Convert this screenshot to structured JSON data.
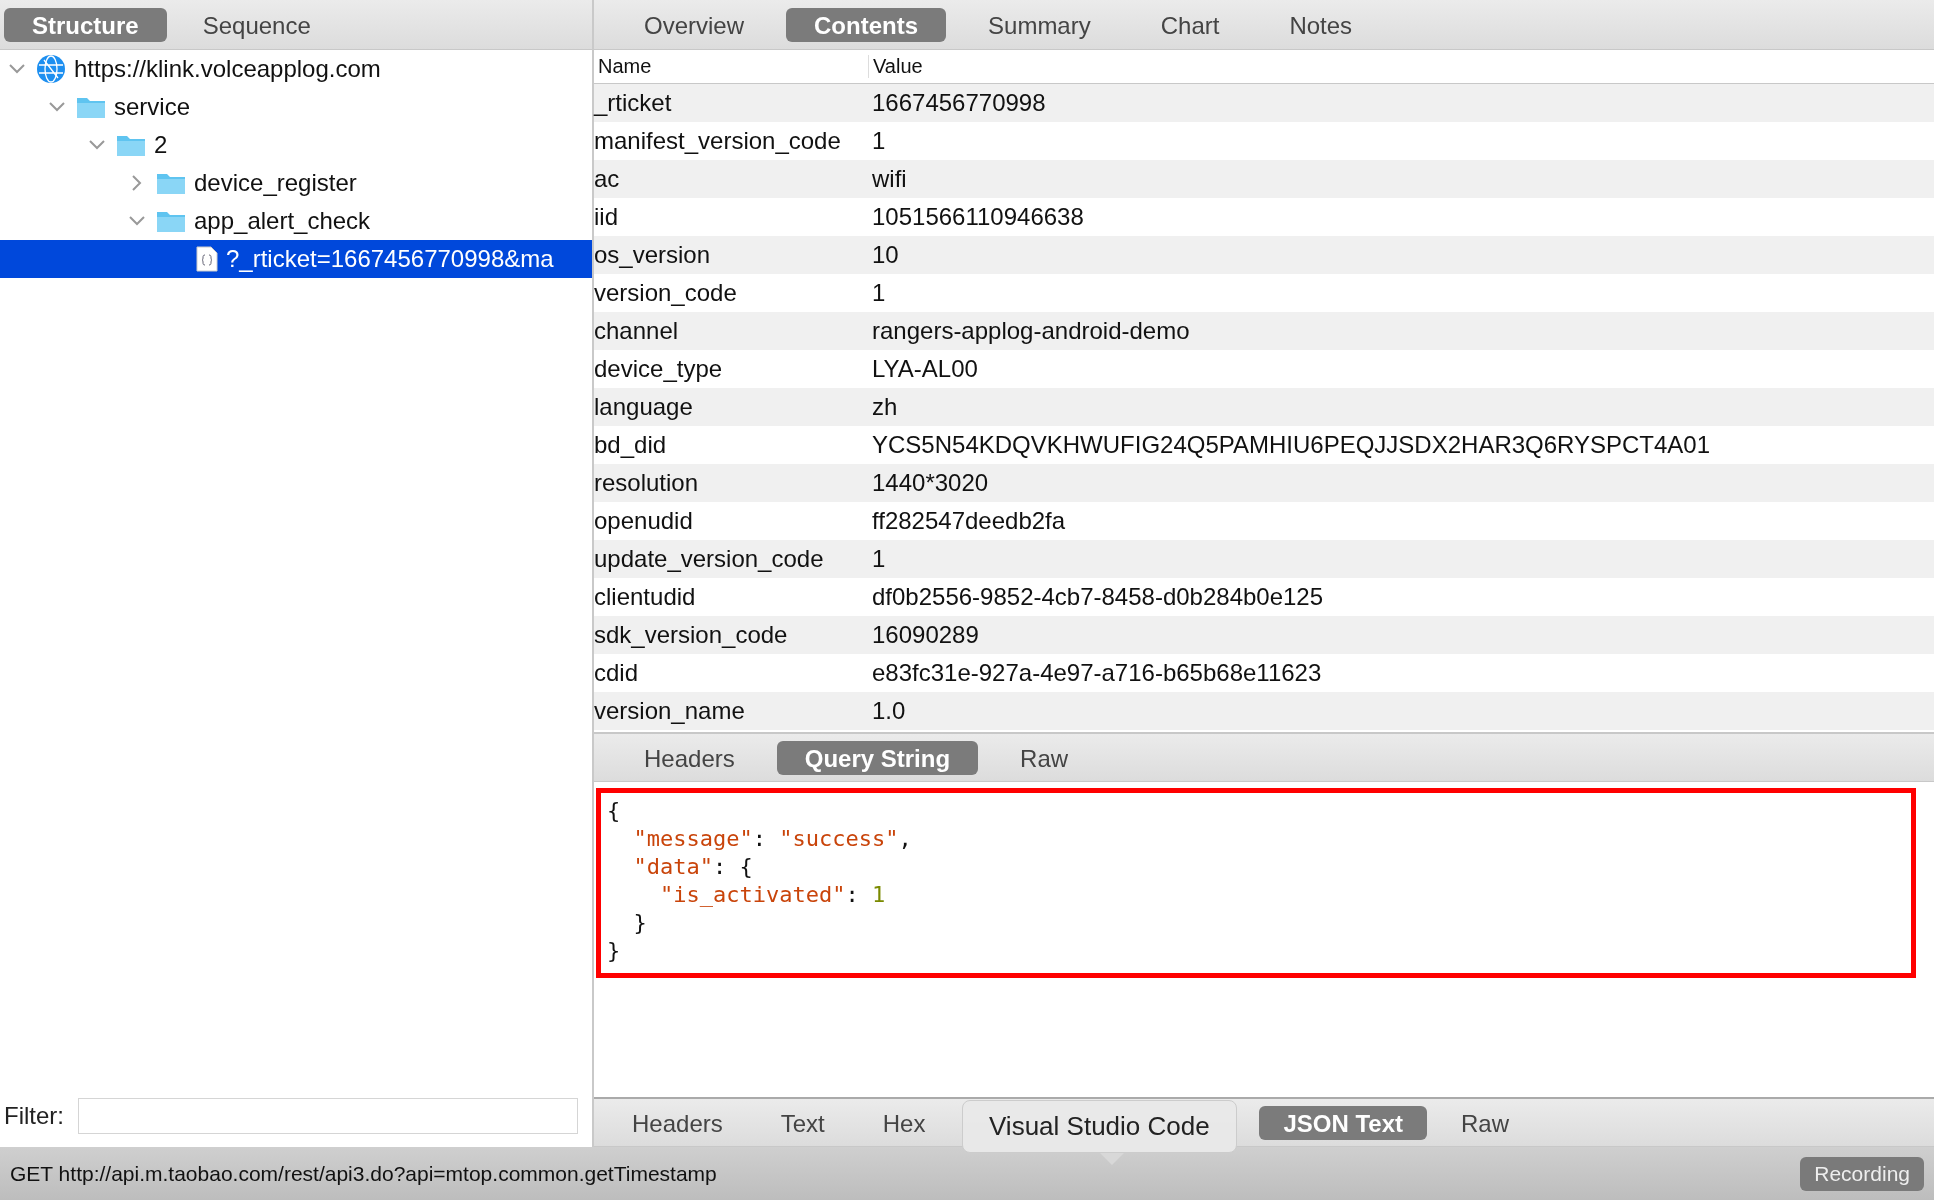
{
  "left_tabs": [
    {
      "label": "Structure",
      "selected": true
    },
    {
      "label": "Sequence",
      "selected": false
    }
  ],
  "tree": [
    {
      "label": "https://klink.volceapplog.com",
      "kind": "host",
      "expanded": true,
      "selected": false,
      "children": [
        {
          "label": "service",
          "kind": "folder",
          "expanded": true,
          "selected": false,
          "children": [
            {
              "label": "2",
              "kind": "folder",
              "expanded": true,
              "selected": false,
              "children": [
                {
                  "label": "device_register",
                  "kind": "folder",
                  "expanded": false,
                  "selected": false
                },
                {
                  "label": "app_alert_check",
                  "kind": "folder",
                  "expanded": true,
                  "selected": false,
                  "children": [
                    {
                      "label": "?_rticket=1667456770998&ma",
                      "kind": "file",
                      "selected": true
                    }
                  ]
                }
              ]
            }
          ]
        }
      ]
    }
  ],
  "filter": {
    "label": "Filter:"
  },
  "right_tabs": [
    {
      "label": "Overview",
      "selected": false
    },
    {
      "label": "Contents",
      "selected": true
    },
    {
      "label": "Summary",
      "selected": false
    },
    {
      "label": "Chart",
      "selected": false
    },
    {
      "label": "Notes",
      "selected": false
    }
  ],
  "table": {
    "columns": [
      "Name",
      "Value"
    ],
    "rows": [
      [
        "_rticket",
        "1667456770998"
      ],
      [
        "manifest_version_code",
        "1"
      ],
      [
        "ac",
        "wifi"
      ],
      [
        "iid",
        "1051566110946638"
      ],
      [
        "os_version",
        "10"
      ],
      [
        "version_code",
        "1"
      ],
      [
        "channel",
        "rangers-applog-android-demo"
      ],
      [
        "device_type",
        "LYA-AL00"
      ],
      [
        "language",
        "zh"
      ],
      [
        "bd_did",
        "YCS5N54KDQVKHWUFIG24Q5PAMHIU6PEQJJSDX2HAR3Q6RYSPCT4A01"
      ],
      [
        "resolution",
        "1440*3020"
      ],
      [
        "openudid",
        "ff282547deedb2fa"
      ],
      [
        "update_version_code",
        "1"
      ],
      [
        "clientudid",
        "df0b2556-9852-4cb7-8458-d0b284b0e125"
      ],
      [
        "sdk_version_code",
        "16090289"
      ],
      [
        "cdid",
        "e83fc31e-927a-4e97-a716-b65b68e11623"
      ],
      [
        "version_name",
        "1.0"
      ]
    ]
  },
  "request_tabs": [
    {
      "label": "Headers",
      "selected": false
    },
    {
      "label": "Query String",
      "selected": true
    },
    {
      "label": "Raw",
      "selected": false
    }
  ],
  "code": [
    [
      {
        "kind": "punct",
        "text": "{"
      }
    ],
    [
      {
        "kind": "key",
        "text": "  \"message\""
      },
      {
        "kind": "punct",
        "text": ": "
      },
      {
        "kind": "string",
        "text": "\"success\""
      },
      {
        "kind": "punct",
        "text": ","
      }
    ],
    [
      {
        "kind": "key",
        "text": "  \"data\""
      },
      {
        "kind": "punct",
        "text": ": {"
      }
    ],
    [
      {
        "kind": "key",
        "text": "    \"is_activated\""
      },
      {
        "kind": "punct",
        "text": ": "
      },
      {
        "kind": "number",
        "text": "1"
      }
    ],
    [
      {
        "kind": "punct",
        "text": "  }"
      }
    ],
    [
      {
        "kind": "punct",
        "text": "}"
      }
    ]
  ],
  "response_tabs": [
    {
      "label": "Headers",
      "selected": false
    },
    {
      "label": "Text",
      "selected": false
    },
    {
      "label": "Hex",
      "selected": false
    },
    {
      "label": "JSON Text",
      "selected": true
    },
    {
      "label": "Raw",
      "selected": false
    }
  ],
  "tooltip": "Visual Studio Code",
  "status_bar": {
    "text": "GET http://api.m.taobao.com/rest/api3.do?api=mtop.common.getTimestamp",
    "button": "Recording"
  }
}
